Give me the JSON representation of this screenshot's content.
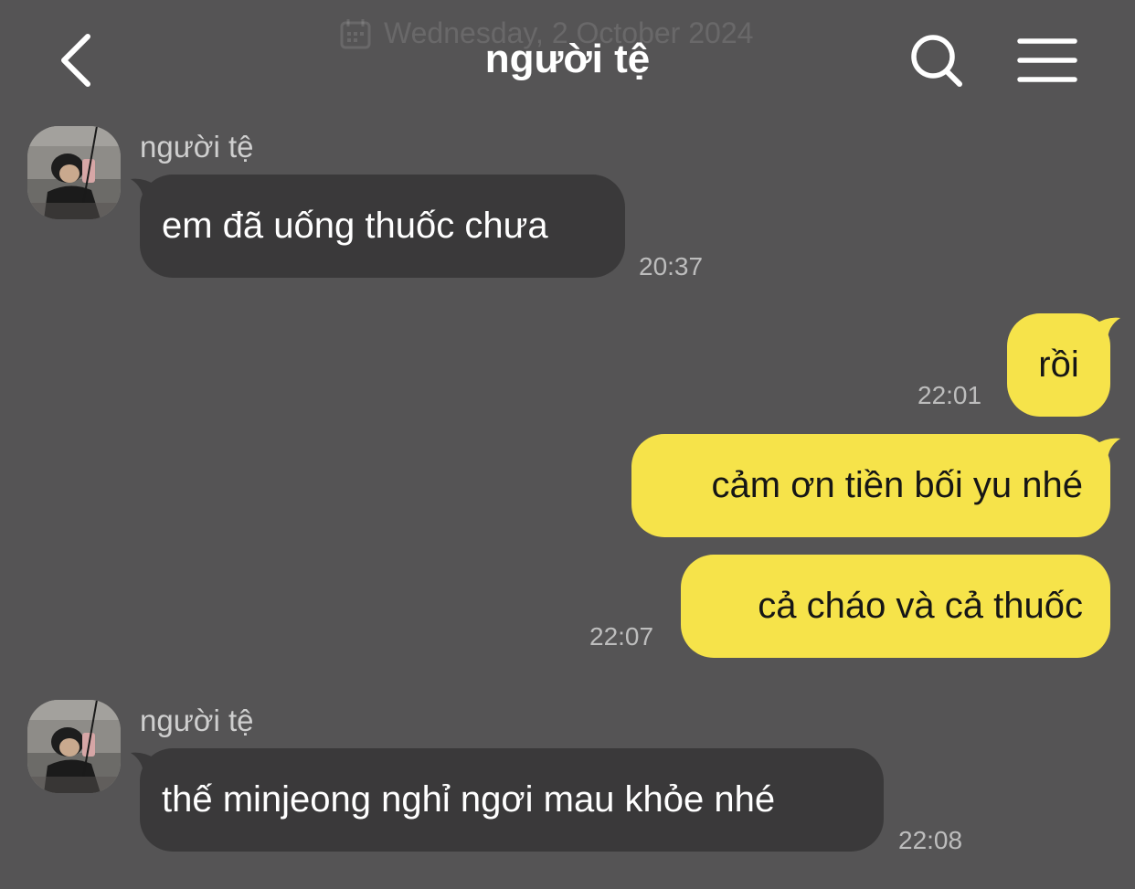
{
  "header": {
    "date_label": "Wednesday, 2 October 2024",
    "title": "người tệ",
    "icons": {
      "back": "chevron-left-icon",
      "search": "search-icon",
      "menu": "hamburger-menu-icon",
      "date": "calendar-icon"
    }
  },
  "messages": [
    {
      "sender": "người tệ",
      "text": "em đã uống thuốc chưa",
      "time": "20:37",
      "direction": "incoming"
    },
    {
      "text": "rồi",
      "time": "22:01",
      "direction": "outgoing"
    },
    {
      "text": "cảm ơn tiền bối yu nhé",
      "direction": "outgoing"
    },
    {
      "text": "cả cháo và cả thuốc",
      "time": "22:07",
      "direction": "outgoing"
    },
    {
      "sender": "người tệ",
      "text": "thế minjeong nghỉ ngơi mau khỏe nhé",
      "time": "22:08",
      "direction": "incoming"
    }
  ],
  "colors": {
    "background": "#555455",
    "incoming_bubble": "#3a393a",
    "outgoing_bubble": "#f6e34a"
  }
}
